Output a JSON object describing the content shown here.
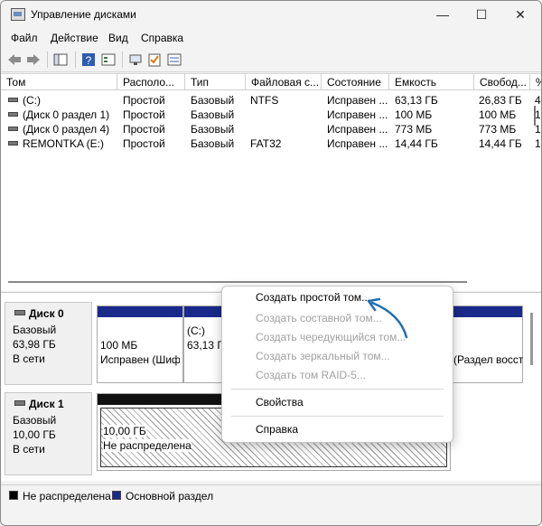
{
  "window": {
    "title": "Управление дисками",
    "controls": {
      "minimize": "—",
      "maximize": "☐",
      "close": "✕"
    }
  },
  "menu": [
    "Файл",
    "Действие",
    "Вид",
    "Справка"
  ],
  "toolbar": {
    "icons": [
      "back-icon",
      "forward-icon",
      "console-tree-icon",
      "help-icon",
      "properties-icon",
      "connect-icon",
      "check-icon",
      "list-icon"
    ]
  },
  "columns": [
    "Том",
    "Располо...",
    "Тип",
    "Файловая с...",
    "Состояние",
    "Емкость",
    "Свобод...",
    "%"
  ],
  "volumes": [
    [
      "(C:)",
      "Простой",
      "Базовый",
      "NTFS",
      "Исправен ...",
      "63,13 ГБ",
      "26,83 ГБ",
      "4"
    ],
    [
      "(Диск 0 раздел 1)",
      "Простой",
      "Базовый",
      "",
      "Исправен ...",
      "100 МБ",
      "100 МБ",
      "1"
    ],
    [
      "(Диск 0 раздел 4)",
      "Простой",
      "Базовый",
      "",
      "Исправен ...",
      "773 МБ",
      "773 МБ",
      "1"
    ],
    [
      "REMONTKA (E:)",
      "Простой",
      "Базовый",
      "FAT32",
      "Исправен ...",
      "14,44 ГБ",
      "14,44 ГБ",
      "1"
    ]
  ],
  "disks": [
    {
      "name": "Диск 0",
      "type": "Базовый",
      "size": "63,98 ГБ",
      "status": "В сети",
      "partitions": [
        {
          "line1": "100 МБ",
          "line2": "Исправен (Шиф"
        },
        {
          "line1": "(C:)",
          "line2": "63,13 Г"
        },
        {
          "line1": "",
          "line2": "(Раздел восст"
        }
      ]
    },
    {
      "name": "Диск 1",
      "type": "Базовый",
      "size": "10,00 ГБ",
      "status": "В сети",
      "partitions": [
        {
          "line1": "10,00 ГБ",
          "line2": "Не распределена"
        }
      ]
    }
  ],
  "legend": [
    {
      "label": "Не распределена",
      "color": "#000000"
    },
    {
      "label": "Основной раздел",
      "color": "#1a2a8a"
    }
  ],
  "context_menu": {
    "items": [
      {
        "label": "Создать простой том...",
        "enabled": true
      },
      {
        "label": "Создать составной том...",
        "enabled": false
      },
      {
        "label": "Создать чередующийся том...",
        "enabled": false
      },
      {
        "label": "Создать зеркальный том...",
        "enabled": false
      },
      {
        "label": "Создать том RAID-5...",
        "enabled": false
      },
      {
        "label": "Свойства",
        "enabled": true
      },
      {
        "label": "Справка",
        "enabled": true
      }
    ]
  },
  "accent_color": "#1a2a8a",
  "annotation_color": "#1e6fb0"
}
